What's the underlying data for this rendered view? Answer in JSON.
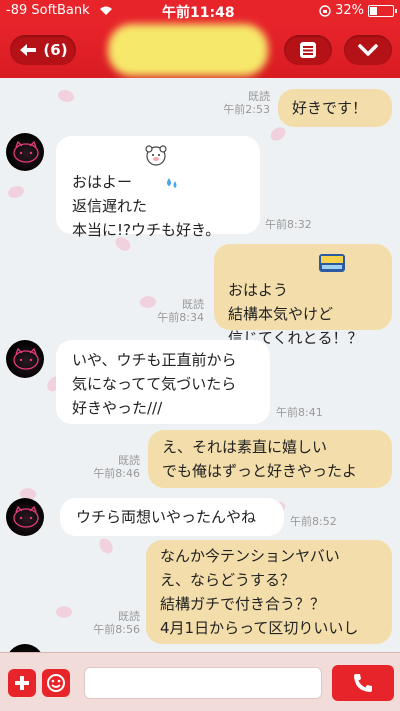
{
  "status_bar": {
    "carrier": "-89 SoftBank",
    "time": "午前11:48",
    "battery": "32%"
  },
  "header": {
    "back_label": "(6)"
  },
  "messages": [
    {
      "dir": "out",
      "text": "好きです！",
      "read": "既読",
      "time": "午前2:53"
    },
    {
      "dir": "in",
      "text": "おはよー\n返信遅れた\n本当に!?ウチも好き。",
      "time": "午前8:32"
    },
    {
      "dir": "out",
      "text": "おはよう\n結構本気やけど\n信じてくれとる！？",
      "read": "既読",
      "time": "午前8:34",
      "sticker": "GOOD Morning"
    },
    {
      "dir": "in",
      "text": "いや、ウチも正直前から\n気になってて気づいたら\n好きやった///",
      "time": "午前8:41"
    },
    {
      "dir": "out",
      "text": "え、それは素直に嬉しい\nでも俺はずっと好きやったよ",
      "read": "既読",
      "time": "午前8:46"
    },
    {
      "dir": "in",
      "text": "ウチら両想いやったんやね",
      "time": "午前8:52"
    },
    {
      "dir": "out",
      "text": "なんか今テンションヤバい\nえ、ならどうする？\n結構ガチで付き合う？？\n4月1日からって区切りいいし",
      "read": "既読",
      "time": "午前8:56"
    }
  ],
  "colors": {
    "header_red": "#e8242b",
    "outgoing_bubble": "#f3deab",
    "incoming_bubble": "#ffffff"
  }
}
